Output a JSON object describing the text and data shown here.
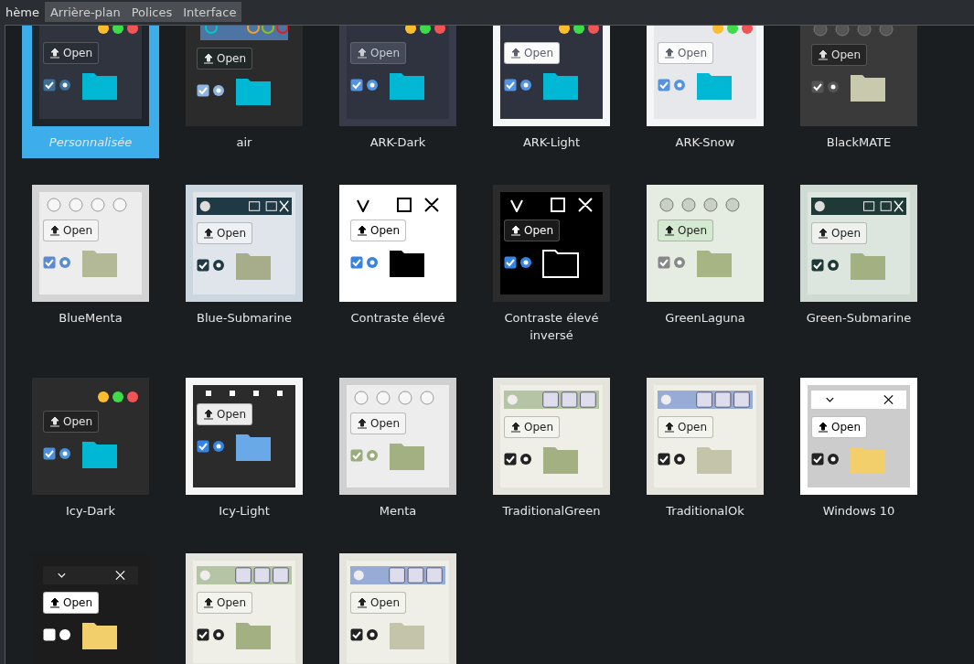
{
  "tabs": [
    {
      "label": "hème",
      "selected": true
    },
    {
      "label": "Arrière-plan",
      "selected": false
    },
    {
      "label": "Polices",
      "selected": false
    },
    {
      "label": "Interface",
      "selected": false
    }
  ],
  "themes": [
    {
      "name": "Personnalisée",
      "selected": true,
      "kind": "custom",
      "button": "Open"
    },
    {
      "name": "air",
      "selected": false,
      "kind": "air",
      "button": "Open"
    },
    {
      "name": "ARK-Dark",
      "selected": false,
      "kind": "arkdark",
      "button": "Open"
    },
    {
      "name": "ARK-Light",
      "selected": false,
      "kind": "arklight",
      "button": "Open"
    },
    {
      "name": "ARK-Snow",
      "selected": false,
      "kind": "arksnow",
      "button": "Open"
    },
    {
      "name": "BlackMATE",
      "selected": false,
      "kind": "blackmate",
      "button": "Open"
    },
    {
      "name": "BlueMenta",
      "selected": false,
      "kind": "bluementa",
      "button": "Open"
    },
    {
      "name": "Blue-Submarine",
      "selected": false,
      "kind": "bluesub",
      "button": "Open"
    },
    {
      "name": "Contraste élevé",
      "selected": false,
      "kind": "contrast",
      "button": "Open"
    },
    {
      "name": "Contraste élevé inversé",
      "selected": false,
      "kind": "contrastinv",
      "button": "Open"
    },
    {
      "name": "GreenLaguna",
      "selected": false,
      "kind": "greenlaguna",
      "button": "Open"
    },
    {
      "name": "Green-Submarine",
      "selected": false,
      "kind": "greensub",
      "button": "Open"
    },
    {
      "name": "Icy-Dark",
      "selected": false,
      "kind": "icydark",
      "button": "Open"
    },
    {
      "name": "Icy-Light",
      "selected": false,
      "kind": "icylight",
      "button": "Open"
    },
    {
      "name": "Menta",
      "selected": false,
      "kind": "menta",
      "button": "Open"
    },
    {
      "name": "TraditionalGreen",
      "selected": false,
      "kind": "tradgreen",
      "button": "Open"
    },
    {
      "name": "TraditionalOk",
      "selected": false,
      "kind": "tradok",
      "button": "Open"
    },
    {
      "name": "Windows 10",
      "selected": false,
      "kind": "win10",
      "button": "Open"
    },
    {
      "selected": false,
      "kind": "win10dark",
      "button": "Open"
    },
    {
      "selected": false,
      "kind": "tradgreen",
      "button": "Open"
    },
    {
      "selected": false,
      "kind": "tradok",
      "button": "Open"
    }
  ]
}
